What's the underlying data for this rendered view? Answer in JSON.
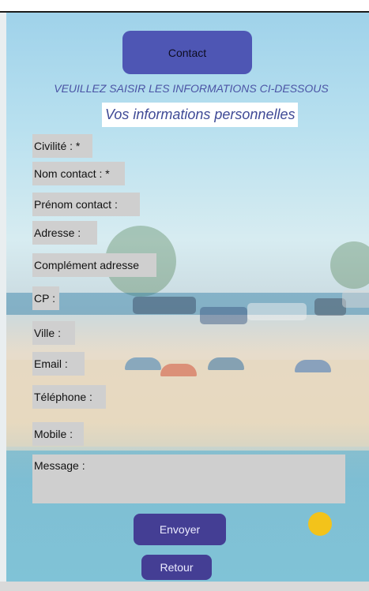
{
  "header": {
    "contact_button": "Contact"
  },
  "instructions": "VEUILLEZ SAISIR LES INFORMATIONS CI-DESSOUS",
  "section_title": "Vos informations personnelles",
  "fields": {
    "civilite": "Civilité : *",
    "nom": "Nom contact : *",
    "prenom": "Prénom contact :",
    "adresse": "Adresse :",
    "complement": "Complément adresse",
    "cp": "CP :",
    "ville": "Ville :",
    "email": "Email :",
    "telephone": "Téléphone :",
    "mobile": "Mobile :",
    "message": "Message :"
  },
  "actions": {
    "send": "Envoyer",
    "back": "Retour"
  },
  "colors": {
    "button": "#4e56b4",
    "button_dark": "#443e94",
    "field_bg": "#cfcfcf",
    "title_text": "#4b54a5"
  },
  "icons": {
    "background": "beach-photo"
  }
}
